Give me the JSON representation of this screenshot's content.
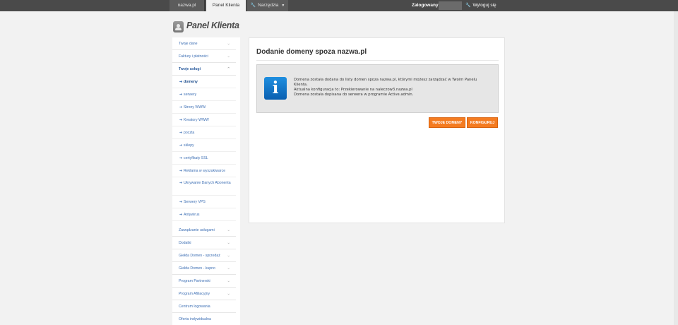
{
  "topbar": {
    "tabs": [
      {
        "label": "nazwa.pl"
      },
      {
        "label": "Panel Klienta"
      },
      {
        "label": "Narzędzia"
      }
    ],
    "logged_label": "Zalogowany:",
    "logout_label": "Wyloguj się"
  },
  "logo": {
    "title": "Panel Klienta"
  },
  "sidebar": {
    "top_items": [
      {
        "label": "Twoje dane"
      },
      {
        "label": "Faktury i płatności"
      },
      {
        "label": "Twoje usługi"
      }
    ],
    "sub_items": [
      {
        "label": "domeny"
      },
      {
        "label": "serwery"
      },
      {
        "label": "Strony WWW"
      },
      {
        "label": "Kreatory WWW"
      },
      {
        "label": "poczta"
      },
      {
        "label": "sklepy"
      },
      {
        "label": "certyfikaty SSL"
      },
      {
        "label": "Reklama w wyszukiwarce"
      },
      {
        "label": "Ukrywanie Danych Abonenta"
      },
      {
        "label": "Serwery VPS"
      },
      {
        "label": "Antywirus"
      }
    ],
    "bottom_items": [
      {
        "label": "Zarządzanie usługami"
      },
      {
        "label": "Dodatki"
      },
      {
        "label": "Giełda Domen - sprzedaż"
      },
      {
        "label": "Giełda Domen - kupno"
      },
      {
        "label": "Program Partnerski"
      },
      {
        "label": "Program Afiliacyjny"
      },
      {
        "label": "Centrum logowania"
      },
      {
        "label": "Oferta indywidualna"
      }
    ]
  },
  "main": {
    "title": "Dodanie domeny spoza nazwa.pl",
    "info": {
      "line1": "Domena została dodana do listy domen spoza nazwa.pl, którymi możesz zarządzać w Twoim Panelu Klienta.",
      "line2": "Aktualna konfiguracja to: Przekierowanie na naleczow3.nazwa.pl",
      "line3": "Domena została dopisana do serwera w programie Active.admin."
    },
    "buttons": {
      "your_domains": "TWOJE DOMENY",
      "configure": "KONFIGURUJ"
    }
  },
  "colors": {
    "accent": "#f47b20",
    "link": "#3d6fb4",
    "topbar": "#4a4a4a",
    "info_icon": "#1a7fd4"
  }
}
